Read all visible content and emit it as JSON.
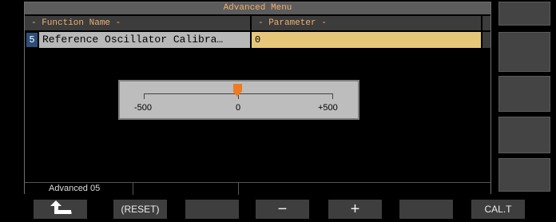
{
  "window": {
    "title": "Advanced Menu"
  },
  "columns": {
    "function_name": "- Function Name -",
    "parameter": "- Parameter -"
  },
  "row": {
    "number": "5",
    "name": "Reference Oscillator Calibra…",
    "value": "0"
  },
  "slider": {
    "min_label": "-500",
    "mid_label": "0",
    "max_label": "+500",
    "current_value": 0,
    "range": [
      -500,
      500
    ]
  },
  "status": {
    "page_label": "Advanced 05"
  },
  "softkeys": {
    "back_icon": "return-arrow-icon",
    "reset": "(RESET)",
    "minus": "−",
    "plus": "+",
    "cal": "CAL.T"
  },
  "colors": {
    "accent": "#f0b070",
    "selected_value_bg": "#e6c77a",
    "row_bg": "#b8b8b8",
    "thumb": "#f07a20"
  }
}
